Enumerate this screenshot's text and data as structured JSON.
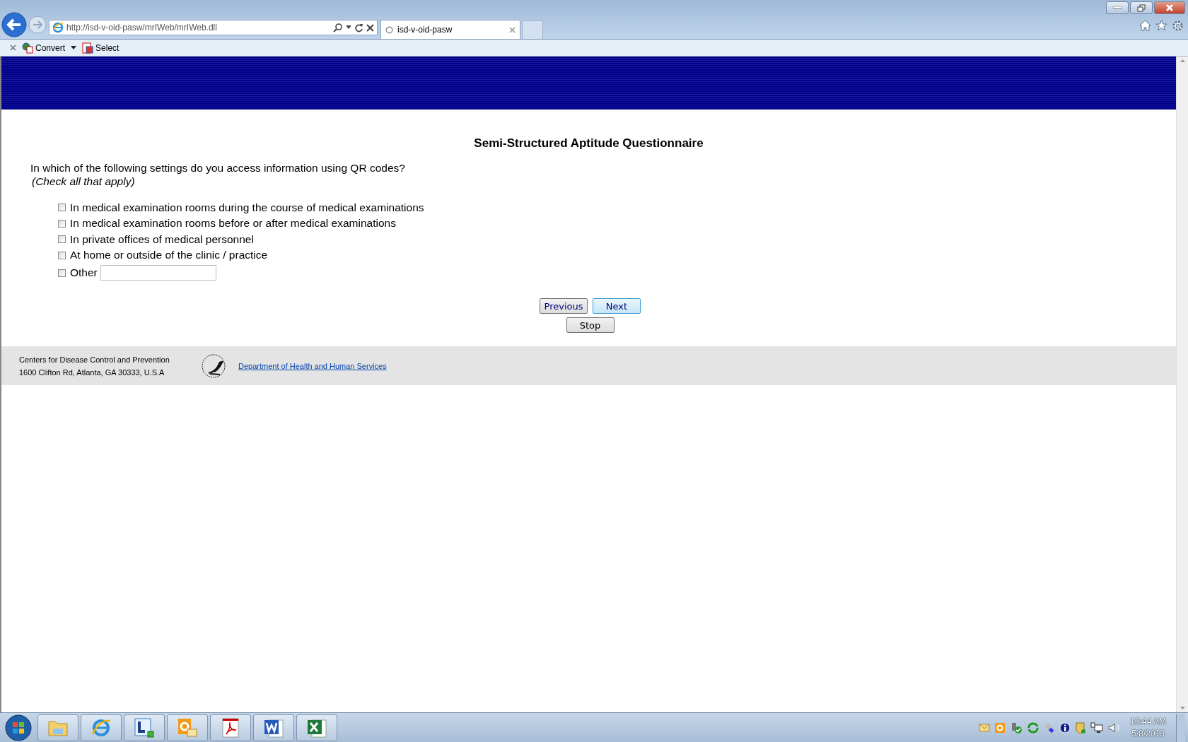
{
  "browser": {
    "address": "http://isd-v-oid-pasw/mrIWeb/mrIWeb.dll",
    "tab_title": "isd-v-oid-pasw",
    "toolbar": [
      {
        "label": "Convert",
        "dropdown": true
      },
      {
        "label": "Select",
        "dropdown": false
      }
    ]
  },
  "survey": {
    "title": "Semi-Structured Aptitude Questionnaire",
    "question": "In which of the following settings do you access information using QR codes?",
    "instruction": "(Check all that apply)",
    "options": [
      {
        "kind": "checkbox",
        "label": "In medical examination rooms during the course of medical examinations",
        "checked": false
      },
      {
        "kind": "checkbox",
        "label": "In medical examination rooms before or after medical examinations",
        "checked": false
      },
      {
        "kind": "checkbox",
        "label": "In private offices of medical personnel",
        "checked": false
      },
      {
        "kind": "checkbox",
        "label": "At home or outside of the clinic / practice",
        "checked": false
      },
      {
        "kind": "other",
        "label": "Other",
        "checked": false
      }
    ],
    "buttons": [
      {
        "label": "Previous",
        "focused": false
      },
      {
        "label": "Next",
        "focused": true
      },
      {
        "label": "Stop",
        "focused": false
      }
    ]
  },
  "footer": {
    "org": "Centers for Disease Control and Prevention",
    "address": "1600 Clifton Rd, Atlanta, GA 30333, U.S.A",
    "link": "Department of Health and Human Services"
  },
  "taskbar": {
    "time": "10:44 AM",
    "date": "5/8/2013"
  }
}
